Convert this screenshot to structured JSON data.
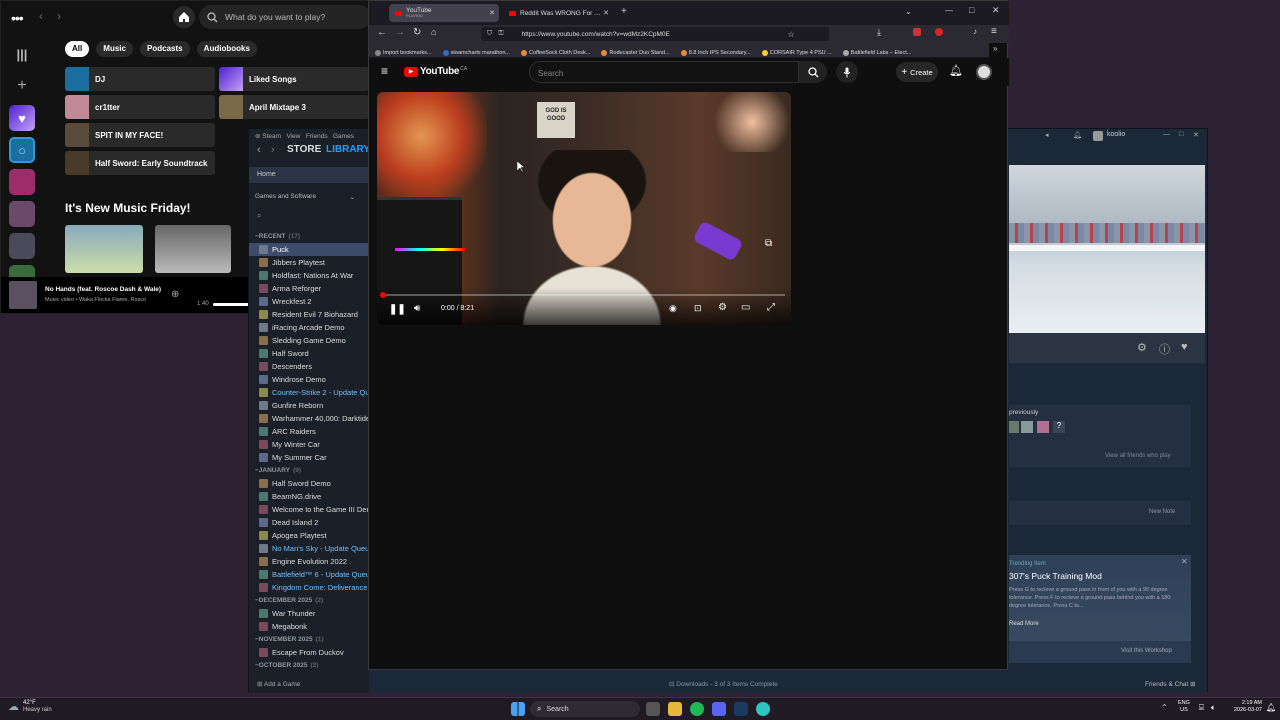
{
  "spotify": {
    "search_placeholder": "What do you want to play?",
    "chips": [
      "All",
      "Music",
      "Podcasts",
      "Audiobooks"
    ],
    "tiles_left": [
      "DJ",
      "cr1tter",
      "SPIT IN MY FACE!",
      "Half Sword: Early Soundtrack"
    ],
    "tiles_right": [
      "Liked Songs",
      "April Mixtape 3"
    ],
    "section_title": "It's New Music Friday!",
    "now_playing": {
      "title": "No Hands (feat. Roscoe Dash & Wale)",
      "subtitle": "Music video • Waka Flocka Flame, Rosco",
      "time": "1:40"
    }
  },
  "steam": {
    "menu": [
      "Steam",
      "View",
      "Friends",
      "Games"
    ],
    "store": "STORE",
    "library": "LIBRARY",
    "home": "Home",
    "filter": "Games and Software",
    "sections": [
      {
        "label": "RECENT",
        "count": "(17)",
        "games": [
          {
            "name": "Puck",
            "sel": true
          },
          {
            "name": "Jibbers Playtest"
          },
          {
            "name": "Holdfast: Nations At War"
          },
          {
            "name": "Arma Reforger"
          },
          {
            "name": "Wreckfest 2"
          },
          {
            "name": "Resident Evil 7 Biohazard"
          },
          {
            "name": "iRacing Arcade Demo"
          },
          {
            "name": "Sledding Game Demo"
          },
          {
            "name": "Half Sword"
          },
          {
            "name": "Descenders"
          },
          {
            "name": "Windrose Demo"
          },
          {
            "name": "Counter-Strike 2 - Update Queu",
            "upd": true
          },
          {
            "name": "Gunfire Reborn"
          },
          {
            "name": "Warhammer 40,000: Darktide"
          },
          {
            "name": "ARC Raiders"
          },
          {
            "name": "My Winter Car"
          },
          {
            "name": "My Summer Car"
          }
        ]
      },
      {
        "label": "JANUARY",
        "count": "(9)",
        "games": [
          {
            "name": "Half Sword Demo"
          },
          {
            "name": "BeamNG.drive"
          },
          {
            "name": "Welcome to the Game III Demo"
          },
          {
            "name": "Dead Island 2"
          },
          {
            "name": "Apogea Playtest"
          },
          {
            "name": "No Man's Sky - Update Queued",
            "upd": true
          },
          {
            "name": "Engine Evolution 2022"
          },
          {
            "name": "Battlefield™ 6 - Update Queued",
            "upd": true
          },
          {
            "name": "Kingdom Come: Deliverance II -",
            "upd": true
          }
        ]
      },
      {
        "label": "DECEMBER 2025",
        "count": "(2)",
        "games": [
          {
            "name": "War Thunder"
          },
          {
            "name": "Megabonk"
          }
        ]
      },
      {
        "label": "NOVEMBER 2025",
        "count": "(1)",
        "games": [
          {
            "name": "Escape From Duckov"
          }
        ]
      },
      {
        "label": "OCTOBER 2025",
        "count": "(2)",
        "games": []
      }
    ],
    "add_game": "Add a Game",
    "downloads": "Downloads - 3 of 3 Items Complete",
    "friends_chat": "Friends & Chat",
    "user": "koolio",
    "played_previously": "previously",
    "view_all_friends": "View all friends who play",
    "new_note": "New Note",
    "workshop": {
      "tag": "Trending Item",
      "title": "307's Puck Training Mod",
      "desc": "Press G to recieve a ground pass in front of you with a 90 degree tolerance. Press F to recieve a ground pass behind you with a 180 degree tolerance. Press C to...",
      "read_more": "Read More",
      "visit": "Visit this Workshop"
    }
  },
  "browser": {
    "tab1_title": "YouTube",
    "tab1_sub": "PLAYING",
    "tab2_title": "Reddit Was WRONG For This -",
    "url": "https://www.youtube.com/watch?v=wdMz2KCpM0E",
    "bookmarks": [
      "Import bookmarks...",
      "steamcharts marathon...",
      "CoffeeSock Cloth Desk...",
      "Rodecaster Duo Stand...",
      "8.8 Inch IPS Secondary...",
      "CORSAIR Type 4 PSU ...",
      "Battlefield Labs – Elect..."
    ]
  },
  "youtube": {
    "logo": "YouTube",
    "region": "CA",
    "search_placeholder": "Search",
    "create": "Create",
    "sign_text": "GOD IS GOOD",
    "time": "0:00 / 8:21",
    "progress": 0.0
  },
  "taskbar": {
    "temp": "42°F",
    "weather": "Heavy rain",
    "search": "Search",
    "lang1": "ENG",
    "lang2": "US",
    "clock": "2:19 AM",
    "date": "2026-03-07"
  }
}
